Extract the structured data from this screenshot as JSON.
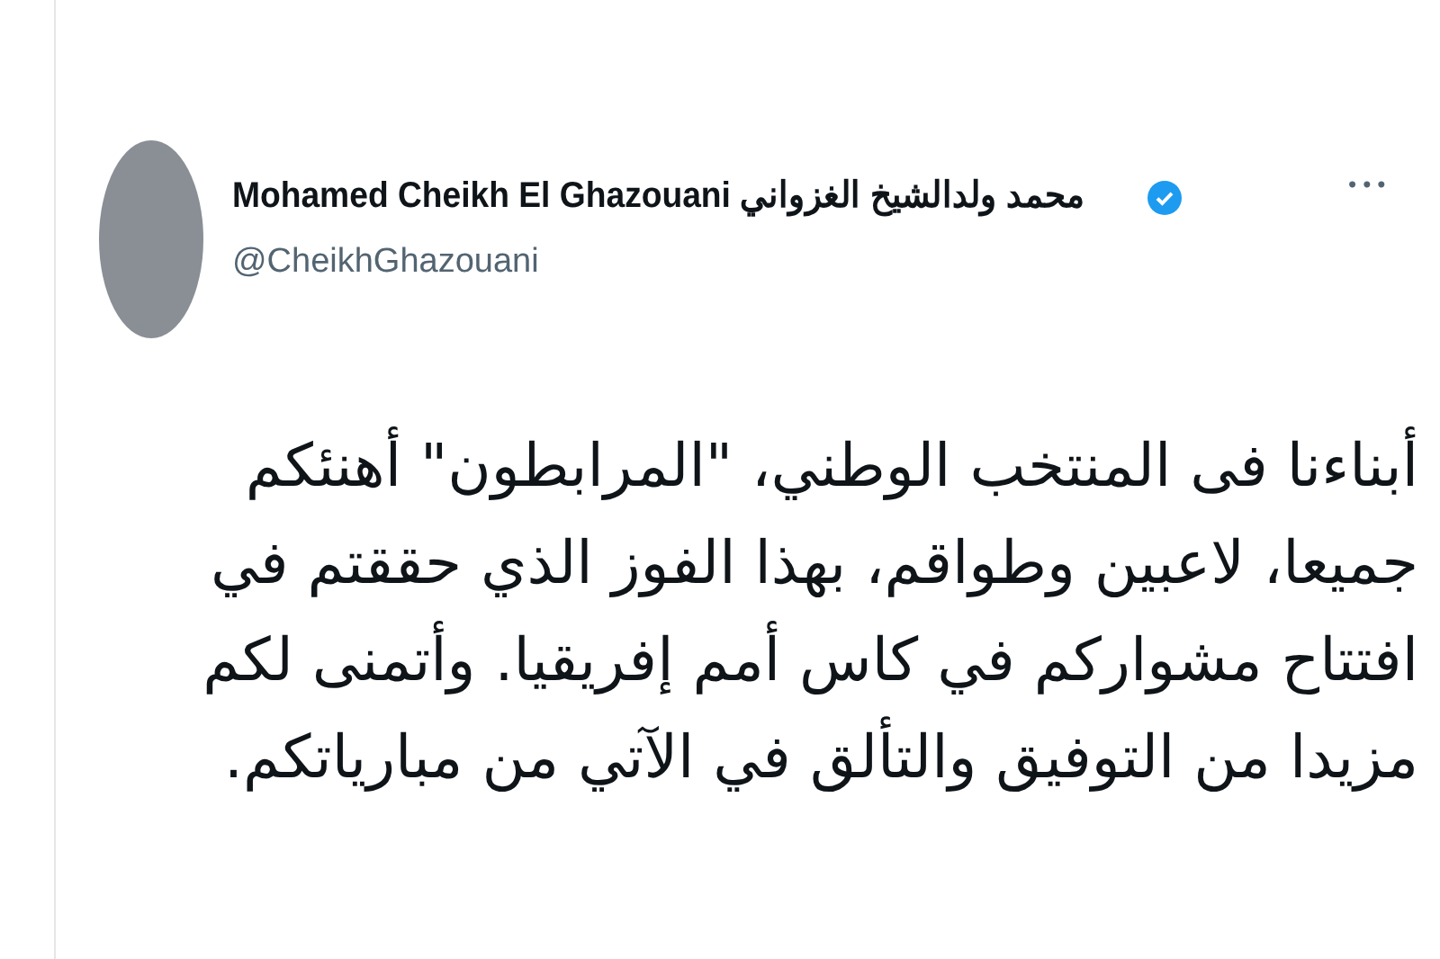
{
  "author": {
    "display_name": "Mohamed Cheikh El Ghazouani محمد ولدالشيخ الغزواني",
    "verified": true,
    "handle": "@CheikhGhazouani"
  },
  "more_menu": "•••",
  "tweet_text": "أبناءنا  فى المنتخب الوطني، \"المرابطون\" أهنئكم جميعا، لاعبين وطواقم،  بهذا الفوز الذي حققتم في افتتاح مشواركم في كاس أمم إفريقيا. وأتمنى لكم مزيدا من التوفيق والتألق في الآتي من مبارياتكم."
}
